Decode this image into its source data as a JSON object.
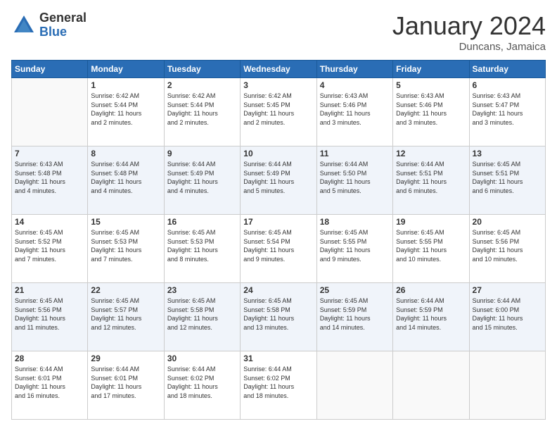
{
  "header": {
    "logo_general": "General",
    "logo_blue": "Blue",
    "month_title": "January 2024",
    "location": "Duncans, Jamaica"
  },
  "days_of_week": [
    "Sunday",
    "Monday",
    "Tuesday",
    "Wednesday",
    "Thursday",
    "Friday",
    "Saturday"
  ],
  "weeks": [
    [
      {
        "day": "",
        "info": ""
      },
      {
        "day": "1",
        "info": "Sunrise: 6:42 AM\nSunset: 5:44 PM\nDaylight: 11 hours\nand 2 minutes."
      },
      {
        "day": "2",
        "info": "Sunrise: 6:42 AM\nSunset: 5:44 PM\nDaylight: 11 hours\nand 2 minutes."
      },
      {
        "day": "3",
        "info": "Sunrise: 6:42 AM\nSunset: 5:45 PM\nDaylight: 11 hours\nand 2 minutes."
      },
      {
        "day": "4",
        "info": "Sunrise: 6:43 AM\nSunset: 5:46 PM\nDaylight: 11 hours\nand 3 minutes."
      },
      {
        "day": "5",
        "info": "Sunrise: 6:43 AM\nSunset: 5:46 PM\nDaylight: 11 hours\nand 3 minutes."
      },
      {
        "day": "6",
        "info": "Sunrise: 6:43 AM\nSunset: 5:47 PM\nDaylight: 11 hours\nand 3 minutes."
      }
    ],
    [
      {
        "day": "7",
        "info": "Sunrise: 6:43 AM\nSunset: 5:48 PM\nDaylight: 11 hours\nand 4 minutes."
      },
      {
        "day": "8",
        "info": "Sunrise: 6:44 AM\nSunset: 5:48 PM\nDaylight: 11 hours\nand 4 minutes."
      },
      {
        "day": "9",
        "info": "Sunrise: 6:44 AM\nSunset: 5:49 PM\nDaylight: 11 hours\nand 4 minutes."
      },
      {
        "day": "10",
        "info": "Sunrise: 6:44 AM\nSunset: 5:49 PM\nDaylight: 11 hours\nand 5 minutes."
      },
      {
        "day": "11",
        "info": "Sunrise: 6:44 AM\nSunset: 5:50 PM\nDaylight: 11 hours\nand 5 minutes."
      },
      {
        "day": "12",
        "info": "Sunrise: 6:44 AM\nSunset: 5:51 PM\nDaylight: 11 hours\nand 6 minutes."
      },
      {
        "day": "13",
        "info": "Sunrise: 6:45 AM\nSunset: 5:51 PM\nDaylight: 11 hours\nand 6 minutes."
      }
    ],
    [
      {
        "day": "14",
        "info": "Sunrise: 6:45 AM\nSunset: 5:52 PM\nDaylight: 11 hours\nand 7 minutes."
      },
      {
        "day": "15",
        "info": "Sunrise: 6:45 AM\nSunset: 5:53 PM\nDaylight: 11 hours\nand 7 minutes."
      },
      {
        "day": "16",
        "info": "Sunrise: 6:45 AM\nSunset: 5:53 PM\nDaylight: 11 hours\nand 8 minutes."
      },
      {
        "day": "17",
        "info": "Sunrise: 6:45 AM\nSunset: 5:54 PM\nDaylight: 11 hours\nand 9 minutes."
      },
      {
        "day": "18",
        "info": "Sunrise: 6:45 AM\nSunset: 5:55 PM\nDaylight: 11 hours\nand 9 minutes."
      },
      {
        "day": "19",
        "info": "Sunrise: 6:45 AM\nSunset: 5:55 PM\nDaylight: 11 hours\nand 10 minutes."
      },
      {
        "day": "20",
        "info": "Sunrise: 6:45 AM\nSunset: 5:56 PM\nDaylight: 11 hours\nand 10 minutes."
      }
    ],
    [
      {
        "day": "21",
        "info": "Sunrise: 6:45 AM\nSunset: 5:56 PM\nDaylight: 11 hours\nand 11 minutes."
      },
      {
        "day": "22",
        "info": "Sunrise: 6:45 AM\nSunset: 5:57 PM\nDaylight: 11 hours\nand 12 minutes."
      },
      {
        "day": "23",
        "info": "Sunrise: 6:45 AM\nSunset: 5:58 PM\nDaylight: 11 hours\nand 12 minutes."
      },
      {
        "day": "24",
        "info": "Sunrise: 6:45 AM\nSunset: 5:58 PM\nDaylight: 11 hours\nand 13 minutes."
      },
      {
        "day": "25",
        "info": "Sunrise: 6:45 AM\nSunset: 5:59 PM\nDaylight: 11 hours\nand 14 minutes."
      },
      {
        "day": "26",
        "info": "Sunrise: 6:44 AM\nSunset: 5:59 PM\nDaylight: 11 hours\nand 14 minutes."
      },
      {
        "day": "27",
        "info": "Sunrise: 6:44 AM\nSunset: 6:00 PM\nDaylight: 11 hours\nand 15 minutes."
      }
    ],
    [
      {
        "day": "28",
        "info": "Sunrise: 6:44 AM\nSunset: 6:01 PM\nDaylight: 11 hours\nand 16 minutes."
      },
      {
        "day": "29",
        "info": "Sunrise: 6:44 AM\nSunset: 6:01 PM\nDaylight: 11 hours\nand 17 minutes."
      },
      {
        "day": "30",
        "info": "Sunrise: 6:44 AM\nSunset: 6:02 PM\nDaylight: 11 hours\nand 18 minutes."
      },
      {
        "day": "31",
        "info": "Sunrise: 6:44 AM\nSunset: 6:02 PM\nDaylight: 11 hours\nand 18 minutes."
      },
      {
        "day": "",
        "info": ""
      },
      {
        "day": "",
        "info": ""
      },
      {
        "day": "",
        "info": ""
      }
    ]
  ]
}
